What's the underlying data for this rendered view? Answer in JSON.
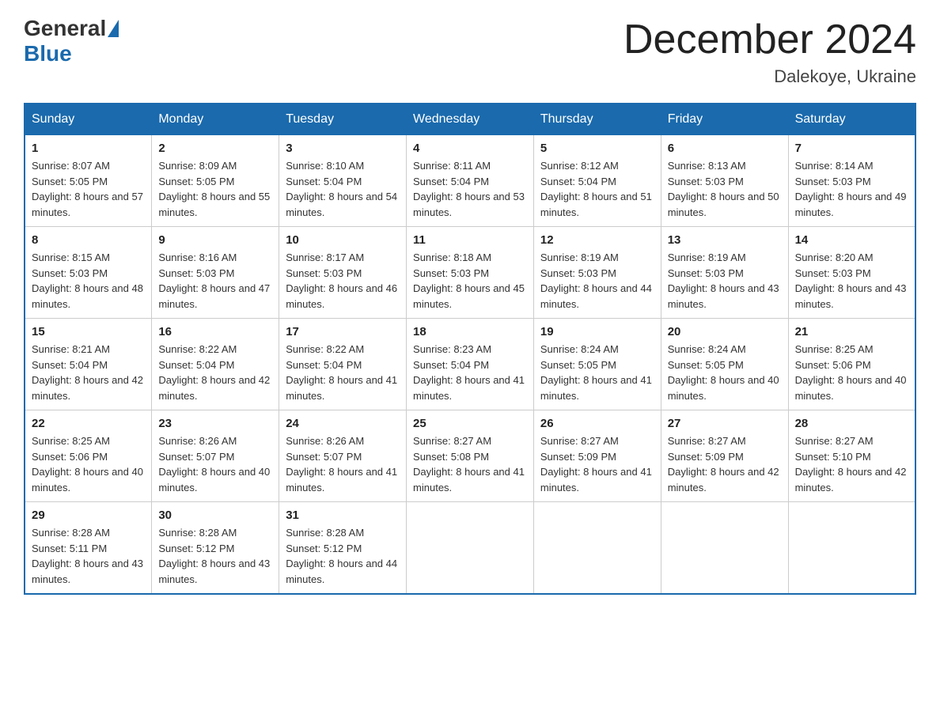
{
  "header": {
    "logo_general": "General",
    "logo_blue": "Blue",
    "month_title": "December 2024",
    "location": "Dalekoye, Ukraine"
  },
  "days_of_week": [
    "Sunday",
    "Monday",
    "Tuesday",
    "Wednesday",
    "Thursday",
    "Friday",
    "Saturday"
  ],
  "weeks": [
    [
      {
        "day": "1",
        "sunrise": "8:07 AM",
        "sunset": "5:05 PM",
        "daylight": "8 hours and 57 minutes."
      },
      {
        "day": "2",
        "sunrise": "8:09 AM",
        "sunset": "5:05 PM",
        "daylight": "8 hours and 55 minutes."
      },
      {
        "day": "3",
        "sunrise": "8:10 AM",
        "sunset": "5:04 PM",
        "daylight": "8 hours and 54 minutes."
      },
      {
        "day": "4",
        "sunrise": "8:11 AM",
        "sunset": "5:04 PM",
        "daylight": "8 hours and 53 minutes."
      },
      {
        "day": "5",
        "sunrise": "8:12 AM",
        "sunset": "5:04 PM",
        "daylight": "8 hours and 51 minutes."
      },
      {
        "day": "6",
        "sunrise": "8:13 AM",
        "sunset": "5:03 PM",
        "daylight": "8 hours and 50 minutes."
      },
      {
        "day": "7",
        "sunrise": "8:14 AM",
        "sunset": "5:03 PM",
        "daylight": "8 hours and 49 minutes."
      }
    ],
    [
      {
        "day": "8",
        "sunrise": "8:15 AM",
        "sunset": "5:03 PM",
        "daylight": "8 hours and 48 minutes."
      },
      {
        "day": "9",
        "sunrise": "8:16 AM",
        "sunset": "5:03 PM",
        "daylight": "8 hours and 47 minutes."
      },
      {
        "day": "10",
        "sunrise": "8:17 AM",
        "sunset": "5:03 PM",
        "daylight": "8 hours and 46 minutes."
      },
      {
        "day": "11",
        "sunrise": "8:18 AM",
        "sunset": "5:03 PM",
        "daylight": "8 hours and 45 minutes."
      },
      {
        "day": "12",
        "sunrise": "8:19 AM",
        "sunset": "5:03 PM",
        "daylight": "8 hours and 44 minutes."
      },
      {
        "day": "13",
        "sunrise": "8:19 AM",
        "sunset": "5:03 PM",
        "daylight": "8 hours and 43 minutes."
      },
      {
        "day": "14",
        "sunrise": "8:20 AM",
        "sunset": "5:03 PM",
        "daylight": "8 hours and 43 minutes."
      }
    ],
    [
      {
        "day": "15",
        "sunrise": "8:21 AM",
        "sunset": "5:04 PM",
        "daylight": "8 hours and 42 minutes."
      },
      {
        "day": "16",
        "sunrise": "8:22 AM",
        "sunset": "5:04 PM",
        "daylight": "8 hours and 42 minutes."
      },
      {
        "day": "17",
        "sunrise": "8:22 AM",
        "sunset": "5:04 PM",
        "daylight": "8 hours and 41 minutes."
      },
      {
        "day": "18",
        "sunrise": "8:23 AM",
        "sunset": "5:04 PM",
        "daylight": "8 hours and 41 minutes."
      },
      {
        "day": "19",
        "sunrise": "8:24 AM",
        "sunset": "5:05 PM",
        "daylight": "8 hours and 41 minutes."
      },
      {
        "day": "20",
        "sunrise": "8:24 AM",
        "sunset": "5:05 PM",
        "daylight": "8 hours and 40 minutes."
      },
      {
        "day": "21",
        "sunrise": "8:25 AM",
        "sunset": "5:06 PM",
        "daylight": "8 hours and 40 minutes."
      }
    ],
    [
      {
        "day": "22",
        "sunrise": "8:25 AM",
        "sunset": "5:06 PM",
        "daylight": "8 hours and 40 minutes."
      },
      {
        "day": "23",
        "sunrise": "8:26 AM",
        "sunset": "5:07 PM",
        "daylight": "8 hours and 40 minutes."
      },
      {
        "day": "24",
        "sunrise": "8:26 AM",
        "sunset": "5:07 PM",
        "daylight": "8 hours and 41 minutes."
      },
      {
        "day": "25",
        "sunrise": "8:27 AM",
        "sunset": "5:08 PM",
        "daylight": "8 hours and 41 minutes."
      },
      {
        "day": "26",
        "sunrise": "8:27 AM",
        "sunset": "5:09 PM",
        "daylight": "8 hours and 41 minutes."
      },
      {
        "day": "27",
        "sunrise": "8:27 AM",
        "sunset": "5:09 PM",
        "daylight": "8 hours and 42 minutes."
      },
      {
        "day": "28",
        "sunrise": "8:27 AM",
        "sunset": "5:10 PM",
        "daylight": "8 hours and 42 minutes."
      }
    ],
    [
      {
        "day": "29",
        "sunrise": "8:28 AM",
        "sunset": "5:11 PM",
        "daylight": "8 hours and 43 minutes."
      },
      {
        "day": "30",
        "sunrise": "8:28 AM",
        "sunset": "5:12 PM",
        "daylight": "8 hours and 43 minutes."
      },
      {
        "day": "31",
        "sunrise": "8:28 AM",
        "sunset": "5:12 PM",
        "daylight": "8 hours and 44 minutes."
      },
      null,
      null,
      null,
      null
    ]
  ]
}
